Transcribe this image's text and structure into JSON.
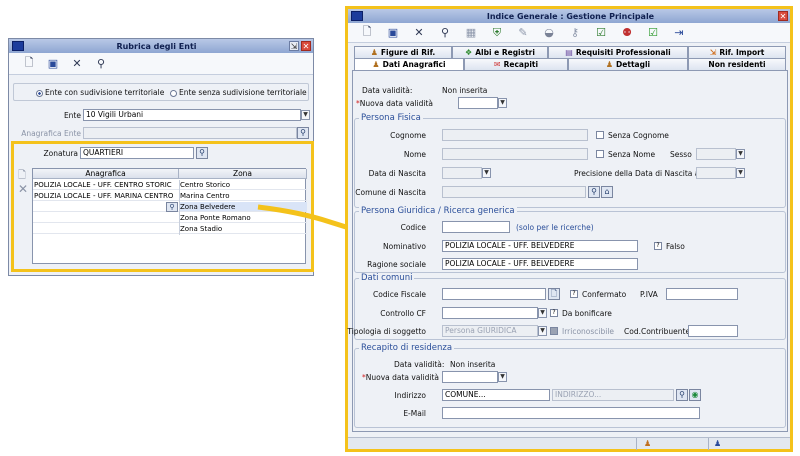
{
  "rubrica": {
    "title": "Rubrica degli Enti",
    "toolbar": [
      {
        "name": "new-icon",
        "glyph": "🗋"
      },
      {
        "name": "save-icon",
        "glyph": "💾"
      },
      {
        "name": "delete-icon",
        "glyph": "✕"
      },
      {
        "name": "binoculars-icon",
        "glyph": "⚲"
      }
    ],
    "radio_with": "Ente con sudivisione territoriale",
    "radio_without": "Ente senza sudivisione territoriale",
    "ente_label": "Ente",
    "ente_value": "10 Vigili Urbani",
    "anagrafica_label": "Anagrafica Ente",
    "zonatura_label": "Zonatura",
    "zonatura_value": "QUARTIERI",
    "grid_headers": [
      "Anagrafica",
      "Zona"
    ],
    "grid_rows": [
      {
        "anagrafica": "POLIZIA LOCALE - UFF. CENTRO STORIC",
        "zona": "Centro Storico"
      },
      {
        "anagrafica": "POLIZIA LOCALE - UFF. MARINA CENTRO",
        "zona": "Marina Centro"
      },
      {
        "anagrafica": "",
        "zona": "Zona Belvedere"
      },
      {
        "anagrafica": "",
        "zona": "Zona Ponte Romano"
      },
      {
        "anagrafica": "",
        "zona": "Zona Stadio"
      }
    ]
  },
  "indice": {
    "title": "Indice Generale : Gestione Principale",
    "tabs_row1": [
      "Figure di Rif.",
      "Albi e Registri",
      "Requisiti Professionali",
      "Rif. Import"
    ],
    "tabs_row2": [
      "Dati Anagrafici",
      "Recapiti",
      "Dettagli",
      "Non residenti"
    ],
    "data_validita_label": "Data validità:",
    "data_validita_value": "Non inserita",
    "nuova_data_label": "Nuova data validità",
    "persona_fisica": {
      "title": "Persona Fisica",
      "cognome": "Cognome",
      "senza_cognome": "Senza Cognome",
      "nome": "Nome",
      "senza_nome": "Senza Nome",
      "sesso": "Sesso",
      "data_nascita": "Data di Nascita",
      "precisione": "Precisione della Data di Nascita al",
      "comune_nascita": "Comune di Nascita"
    },
    "persona_giuridica": {
      "title": "Persona Giuridica / Ricerca generica",
      "codice": "Codice",
      "solo_ricerche": "(solo per le ricerche)",
      "nominativo": "Nominativo",
      "nominativo_value": "POLIZIA LOCALE - UFF. BELVEDERE",
      "falso": "Falso",
      "ragione_sociale": "Ragione sociale",
      "ragione_sociale_value": "POLIZIA LOCALE - UFF. BELVEDERE"
    },
    "dati_comuni": {
      "title": "Dati comuni",
      "codice_fiscale": "Codice Fiscale",
      "confermato": "Confermato",
      "piva": "P.IVA",
      "controllo_cf": "Controllo CF",
      "da_bonificare": "Da bonificare",
      "tipologia": "Tipologia di soggetto",
      "tipologia_value": "Persona GIURIDICA",
      "irriconoscibile": "Irriconoscibile",
      "cod_contribuente": "Cod.Contribuente"
    },
    "recapito": {
      "title": "Recapito di residenza",
      "data_validita_label": "Data validità:",
      "data_validita_value": "Non inserita",
      "nuova_data_label": "Nuova data validità",
      "indirizzo": "Indirizzo",
      "comune_value": "COMUNE...",
      "indirizzo_placeholder": "INDIRIZZO...",
      "email": "E-Mail"
    }
  },
  "colors": {
    "highlight": "#f4c21b",
    "section_title": "#2b4f9a",
    "required": "#d02020"
  }
}
